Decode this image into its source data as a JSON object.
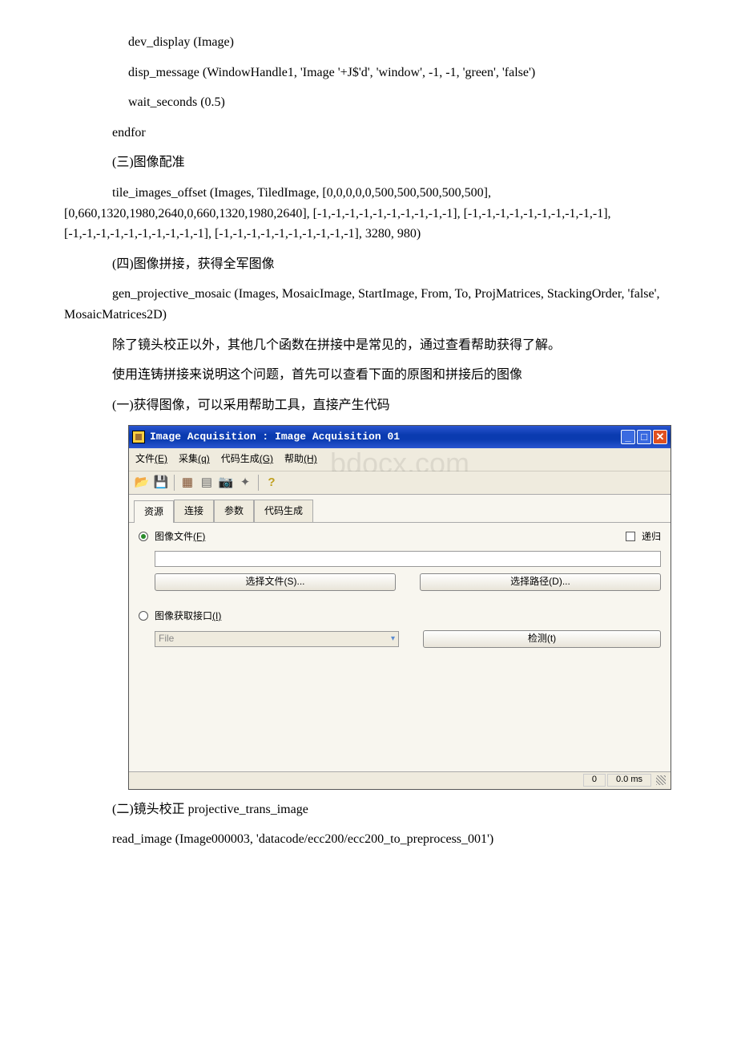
{
  "doc": {
    "lines": [
      "dev_display (Image)",
      "disp_message (WindowHandle1, 'Image '+J$'d', 'window', -1, -1, 'green', 'false')",
      "wait_seconds (0.5)",
      "endfor",
      "(三)图像配准",
      "tile_images_offset (Images, TiledImage, [0,0,0,0,0,500,500,500,500,500], [0,660,1320,1980,2640,0,660,1320,1980,2640], [-1,-1,-1,-1,-1,-1,-1,-1,-1,-1], [-1,-1,-1,-1,-1,-1,-1,-1,-1,-1], [-1,-1,-1,-1,-1,-1,-1,-1,-1,-1], [-1,-1,-1,-1,-1,-1,-1,-1,-1,-1], 3280, 980)",
      "(四)图像拼接，获得全军图像",
      "gen_projective_mosaic (Images, MosaicImage, StartImage, From, To, ProjMatrices, StackingOrder, 'false', MosaicMatrices2D)",
      "除了镜头校正以外，其他几个函数在拼接中是常见的，通过查看帮助获得了解。",
      "使用连铸拼接来说明这个问题，首先可以查看下面的原图和拼接后的图像",
      "(一)获得图像，可以采用帮助工具，直接产生代码"
    ],
    "after_lines": [
      "(二)镜头校正 projective_trans_image",
      "read_image (Image000003, 'datacode/ecc200/ecc200_to_preprocess_001')"
    ]
  },
  "window": {
    "title": "Image Acquisition : Image Acquisition 01",
    "menu": {
      "file": "文件",
      "file_hk": "(E)",
      "acq": "采集",
      "acq_hk": "(q)",
      "gen": "代码生成",
      "gen_hk": "(G)",
      "help": "帮助",
      "help_hk": "(H)"
    },
    "watermark": "bdocx.com",
    "tabs": {
      "t1": "资源",
      "t2": "连接",
      "t3": "参数",
      "t4": "代码生成"
    },
    "form": {
      "image_file_label": "图像文件",
      "image_file_hk": "(F)",
      "recursive_label": "递归",
      "select_file_btn": "选择文件(S)...",
      "select_path_btn": "选择路径(D)...",
      "interface_label": "图像获取接口",
      "interface_hk": "(I)",
      "interface_value": "File",
      "detect_btn": "检测(t)"
    },
    "status": {
      "count": "0",
      "time": "0.0 ms"
    }
  }
}
